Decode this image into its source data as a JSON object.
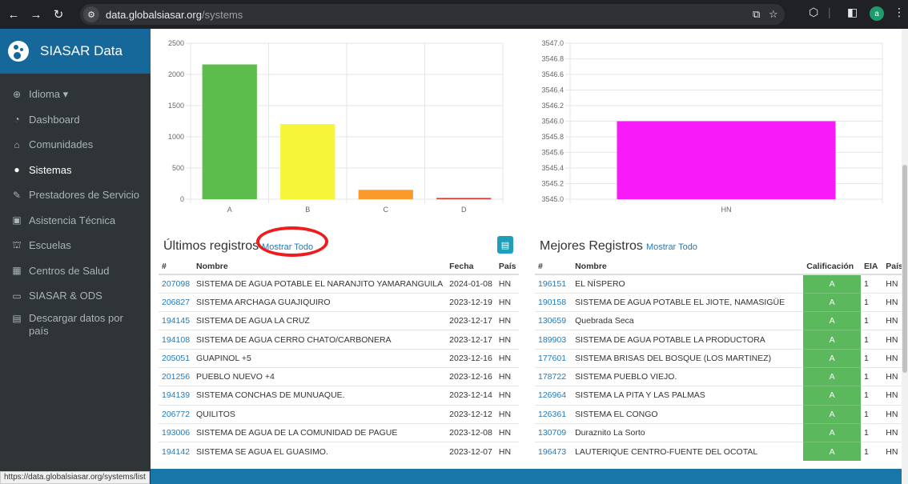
{
  "browser": {
    "url_host": "data.globalsiasar.org",
    "url_path": "/systems",
    "avatar_letter": "a",
    "status_url": "https://data.globalsiasar.org/systems/list"
  },
  "sidebar": {
    "brand": "SIASAR Data",
    "items": [
      {
        "label": "Idioma ▾",
        "icon": "globe-icon",
        "glyph": "⊕"
      },
      {
        "label": "Dashboard",
        "icon": "dashboard-icon",
        "glyph": "◔"
      },
      {
        "label": "Comunidades",
        "icon": "home-icon",
        "glyph": "⌂"
      },
      {
        "label": "Sistemas",
        "icon": "water-drop-icon",
        "glyph": "●"
      },
      {
        "label": "Prestadores de Servicio",
        "icon": "wrench-icon",
        "glyph": "✎"
      },
      {
        "label": "Asistencia Técnica",
        "icon": "clipboard-icon",
        "glyph": "▣"
      },
      {
        "label": "Escuelas",
        "icon": "school-icon",
        "glyph": "⛫"
      },
      {
        "label": "Centros de Salud",
        "icon": "hospital-icon",
        "glyph": "▦"
      },
      {
        "label": "SIASAR & ODS",
        "icon": "monitor-icon",
        "glyph": "▭"
      },
      {
        "label": "Descargar datos por país",
        "icon": "excel-file-icon",
        "glyph": "▤"
      }
    ]
  },
  "chart_data": [
    {
      "type": "bar",
      "categories": [
        "A",
        "B",
        "C",
        "D"
      ],
      "values": [
        2160,
        1205,
        150,
        20
      ],
      "colors": [
        "#5cbd4c",
        "#f7f53a",
        "#f99a2b",
        "#e0312a"
      ],
      "ylim": [
        0,
        2500
      ],
      "yticks": [
        0,
        500,
        1000,
        1500,
        2000,
        2500
      ],
      "grid": true
    },
    {
      "type": "bar",
      "categories": [
        "HN"
      ],
      "values": [
        3546.0
      ],
      "colors": [
        "#f91af9"
      ],
      "ylim": [
        3545.0,
        3547.0
      ],
      "yticks": [
        "3545.0",
        "3545.2",
        "3545.4",
        "3545.6",
        "3545.8",
        "3546.0",
        "3546.2",
        "3546.4",
        "3546.6",
        "3546.8",
        "3547.0"
      ],
      "grid": true
    }
  ],
  "latest": {
    "title": "Últimos registros",
    "show_all": "Mostrar Todo",
    "headers": [
      "#",
      "Nombre",
      "Fecha",
      "País"
    ],
    "rows": [
      [
        "207098",
        "SISTEMA DE AGUA POTABLE EL NARANJITO YAMARANGUILA",
        "2024-01-08",
        "HN"
      ],
      [
        "206827",
        "SISTEMA ARCHAGA GUAJIQUIRO",
        "2023-12-19",
        "HN"
      ],
      [
        "194145",
        "SISTEMA DE AGUA LA CRUZ",
        "2023-12-17",
        "HN"
      ],
      [
        "194108",
        "SISTEMA DE AGUA CERRO CHATO/CARBONERA",
        "2023-12-17",
        "HN"
      ],
      [
        "205051",
        "GUAPINOL +5",
        "2023-12-16",
        "HN"
      ],
      [
        "201256",
        "PUEBLO NUEVO +4",
        "2023-12-16",
        "HN"
      ],
      [
        "194139",
        "SISTEMA CONCHAS DE MUNUAQUE.",
        "2023-12-14",
        "HN"
      ],
      [
        "206772",
        "QUILITOS",
        "2023-12-12",
        "HN"
      ],
      [
        "193006",
        "SISTEMA DE AGUA DE LA COMUNIDAD DE PAGUE",
        "2023-12-08",
        "HN"
      ],
      [
        "194142",
        "SISTEMA SE AGUA EL GUASIMO.",
        "2023-12-07",
        "HN"
      ]
    ]
  },
  "best": {
    "title": "Mejores Registros",
    "show_all": "Mostrar Todo",
    "headers": [
      "#",
      "Nombre",
      "Calificación",
      "EIA",
      "País"
    ],
    "rows": [
      [
        "196151",
        "EL NÍSPERO",
        "A",
        "1",
        "HN"
      ],
      [
        "190158",
        "SISTEMA DE AGUA POTABLE EL JIOTE, NAMASIGÜE",
        "A",
        "1",
        "HN"
      ],
      [
        "130659",
        "Quebrada Seca",
        "A",
        "1",
        "HN"
      ],
      [
        "189903",
        "SISTEMA DE AGUA POTABLE LA PRODUCTORA",
        "A",
        "1",
        "HN"
      ],
      [
        "177601",
        "SISTEMA BRISAS DEL BOSQUE (LOS MARTINEZ)",
        "A",
        "1",
        "HN"
      ],
      [
        "178722",
        "SISTEMA PUEBLO VIEJO.",
        "A",
        "1",
        "HN"
      ],
      [
        "126964",
        "SISTEMA LA PITA Y LAS PALMAS",
        "A",
        "1",
        "HN"
      ],
      [
        "126361",
        "SISTEMA EL CONGO",
        "A",
        "1",
        "HN"
      ],
      [
        "130709",
        "Duraznito La Sorto",
        "A",
        "1",
        "HN"
      ],
      [
        "196473",
        "LAUTERIQUE CENTRO-FUENTE DEL OCOTAL",
        "A",
        "1",
        "HN"
      ]
    ]
  }
}
